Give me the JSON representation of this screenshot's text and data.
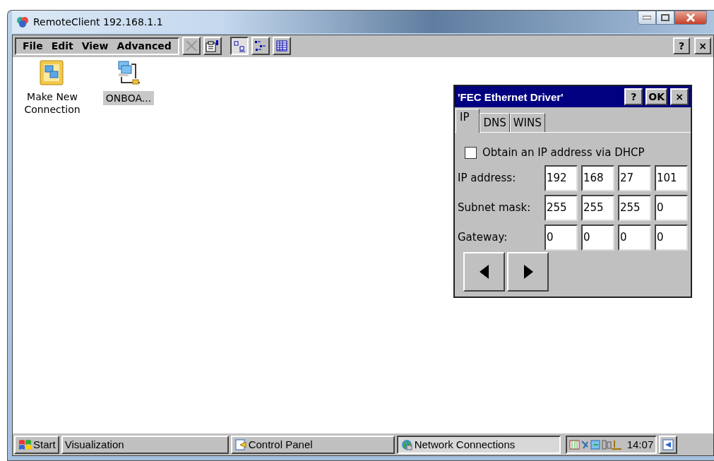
{
  "window": {
    "title": "RemoteClient 192.168.1.1"
  },
  "menu": [
    "File",
    "Edit",
    "View",
    "Advanced"
  ],
  "toolbar": [
    {
      "kind": "delete",
      "selected": false
    },
    {
      "kind": "properties",
      "selected": false
    },
    {
      "kind": "large-icons",
      "selected": true
    },
    {
      "kind": "small-icons",
      "selected": false
    },
    {
      "kind": "details",
      "selected": false
    }
  ],
  "menu_buttons": [
    "?",
    "×"
  ],
  "icons": [
    {
      "kind": "wizard",
      "label": "Make New Connection",
      "selected": false
    },
    {
      "kind": "connection",
      "label": "ONBOA...",
      "selected": true
    }
  ],
  "dialog": {
    "title": "'FEC Ethernet Driver'",
    "buttons": [
      "?",
      "OK",
      "×"
    ],
    "tabs": [
      {
        "label": "IP",
        "selected": true
      },
      {
        "label": "DNS",
        "selected": false
      },
      {
        "label": "WINS",
        "selected": false
      }
    ],
    "dhcp": {
      "label": "Obtain an IP address via DHCP",
      "checked": false
    },
    "fields": [
      {
        "label": "IP address:",
        "octets": [
          "192",
          "168",
          "27",
          "101"
        ]
      },
      {
        "label": "Subnet mask:",
        "octets": [
          "255",
          "255",
          "255",
          "0"
        ]
      },
      {
        "label": "Gateway:",
        "octets": [
          "0",
          "0",
          "0",
          "0"
        ]
      }
    ],
    "nav": [
      {
        "kind": "left"
      },
      {
        "kind": "right"
      }
    ]
  },
  "taskbar": {
    "start": "Start",
    "tasks": [
      {
        "kind": "plain",
        "label": "Visualization",
        "selected": false
      },
      {
        "kind": "control-panel",
        "label": "Control Panel",
        "selected": false
      },
      {
        "kind": "network",
        "label": "Network Connections",
        "selected": true
      }
    ],
    "clock": "14:07"
  }
}
